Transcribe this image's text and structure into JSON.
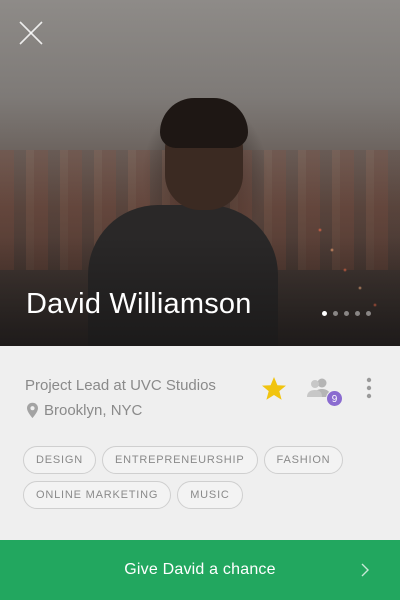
{
  "profile": {
    "name": "David Williamson",
    "role": "Project Lead at UVC Studios",
    "location": "Brooklyn, NYC",
    "photo_count": 5,
    "active_photo": 1
  },
  "actions": {
    "star_icon": "star-icon",
    "friends_icon": "people-icon",
    "friends_count": "9",
    "more_icon": "vertical-dots-icon",
    "close_icon": "close-icon"
  },
  "tags": [
    "DESIGN",
    "ENTREPRENEURSHIP",
    "FASHION",
    "ONLINE MARKETING",
    "MUSIC"
  ],
  "cta": {
    "label": "Give David a chance"
  },
  "colors": {
    "accent_green": "#22a75f",
    "star_yellow": "#f1c40f",
    "badge_purple": "#8a6bd0",
    "muted_text": "#8a8a8a"
  }
}
